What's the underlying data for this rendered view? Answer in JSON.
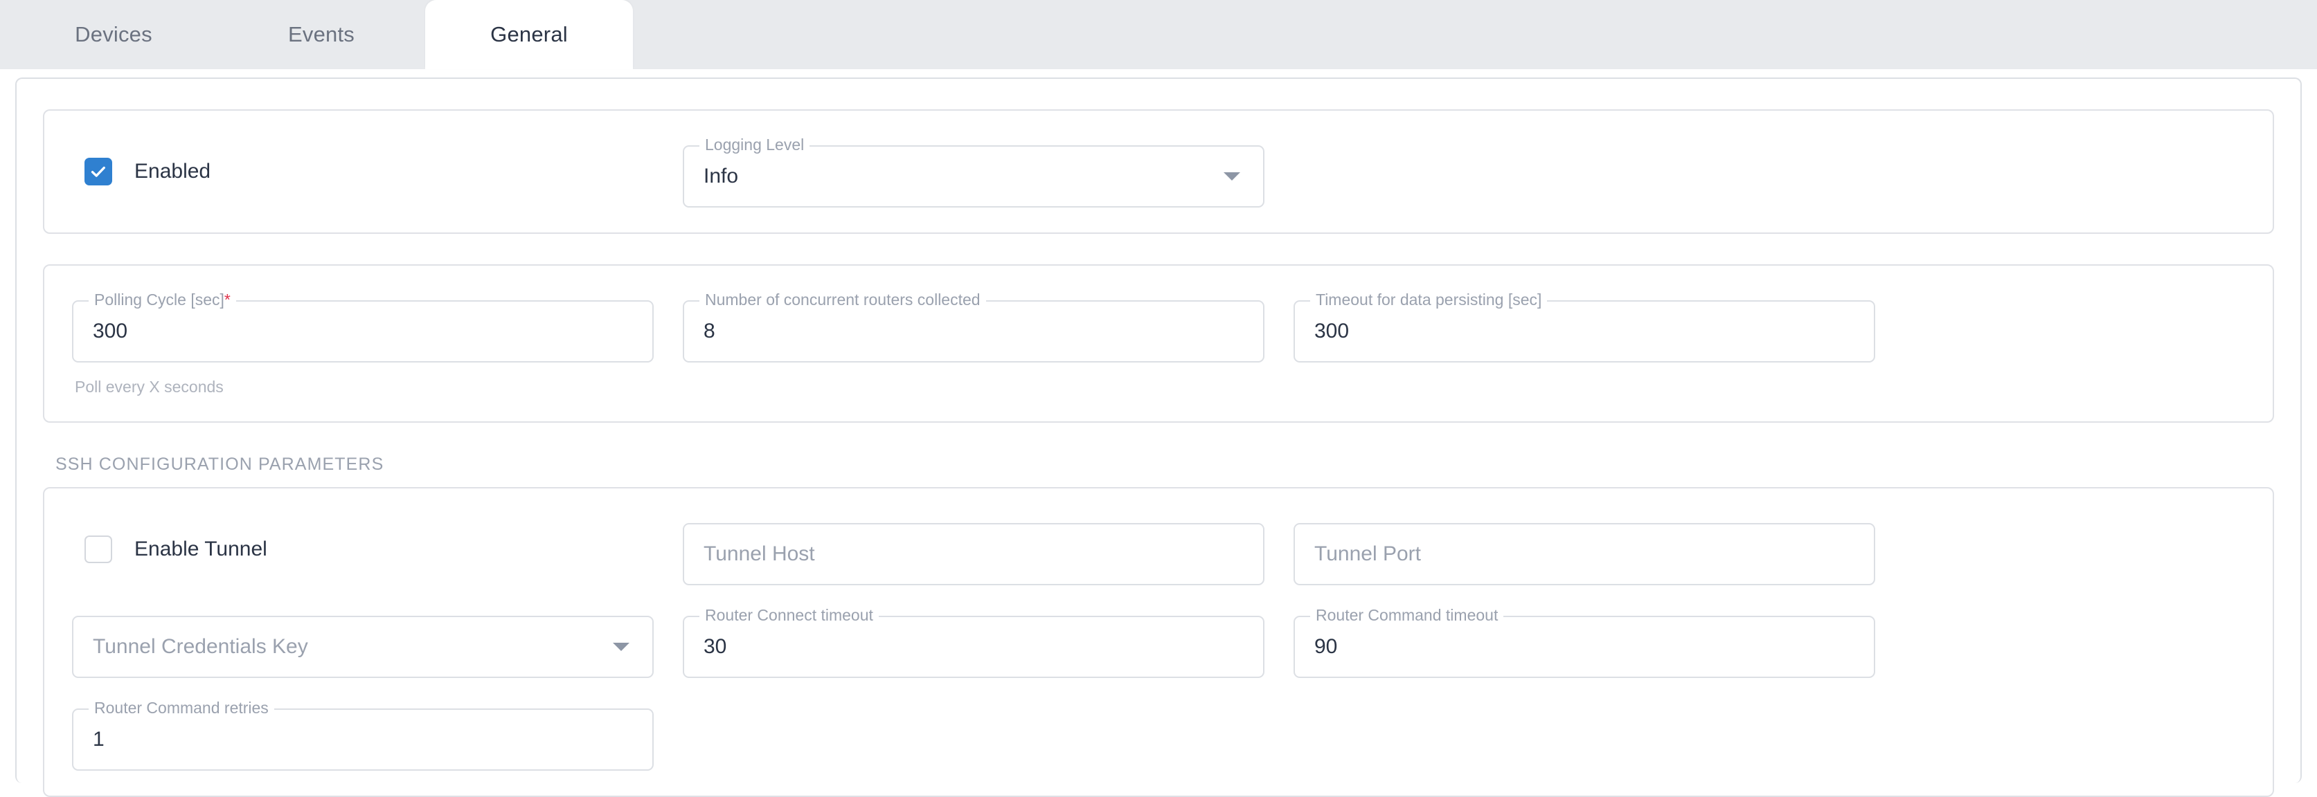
{
  "tabs": [
    {
      "label": "Devices",
      "active": false
    },
    {
      "label": "Events",
      "active": false
    },
    {
      "label": "General",
      "active": true
    }
  ],
  "colors": {
    "accent": "#2f80d0",
    "required": "#e0314b",
    "tabbar_bg": "#e8eaed",
    "border": "#dcdfe4",
    "label": "#9aa1ae",
    "text": "#2b3445"
  },
  "general_card": {
    "enabled_checkbox": {
      "label": "Enabled",
      "checked": true
    },
    "logging_level": {
      "label": "Logging Level",
      "value": "Info"
    }
  },
  "polling_card": {
    "polling_cycle": {
      "label": "Polling Cycle [sec]",
      "required_marker": "*",
      "value": "300",
      "helper": "Poll every X seconds"
    },
    "concurrent_routers": {
      "label": "Number of concurrent routers collected",
      "value": "8"
    },
    "persist_timeout": {
      "label": "Timeout for data persisting [sec]",
      "value": "300"
    }
  },
  "ssh_section": {
    "title": "SSH CONFIGURATION PARAMETERS",
    "enable_tunnel": {
      "label": "Enable Tunnel",
      "checked": false
    },
    "tunnel_host": {
      "placeholder": "Tunnel Host",
      "value": ""
    },
    "tunnel_port": {
      "placeholder": "Tunnel Port",
      "value": ""
    },
    "tunnel_credentials_key": {
      "placeholder": "Tunnel Credentials Key",
      "value": ""
    },
    "router_connect_timeout": {
      "label": "Router Connect timeout",
      "value": "30"
    },
    "router_command_timeout": {
      "label": "Router Command timeout",
      "value": "90"
    },
    "router_command_retries": {
      "label": "Router Command retries",
      "value": "1"
    }
  }
}
